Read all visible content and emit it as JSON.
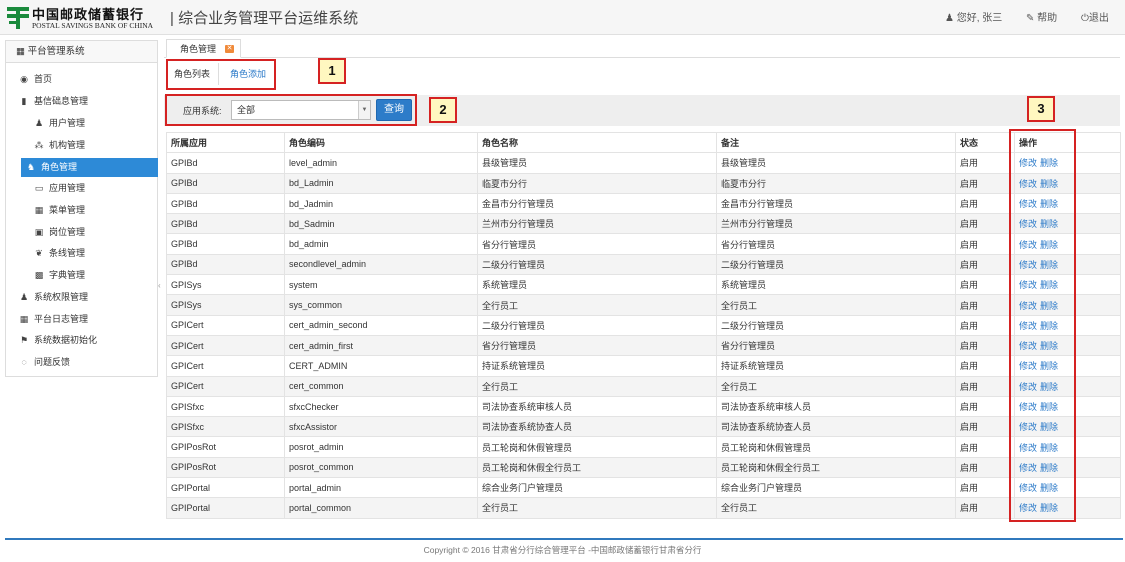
{
  "header": {
    "logo_cn": "中国邮政储蓄银行",
    "logo_en": "POSTAL SAVINGS BANK OF CHINA",
    "app_title": "| 综合业务管理平台运维系统",
    "user_greeting": "您好, 张三",
    "help": "帮助",
    "logout": "退出",
    "brand_color": "#1a8a3c"
  },
  "sidebar": {
    "title": "平台管理系统",
    "items": [
      {
        "icon": "globe-icon",
        "glyph": "◉",
        "label": "首页"
      },
      {
        "icon": "book-icon",
        "glyph": "▮",
        "label": "基信础息管理"
      },
      {
        "icon": "user-icon",
        "glyph": "♟",
        "label": "用户管理"
      },
      {
        "icon": "sitemap-icon",
        "glyph": "⁂",
        "label": "机构管理"
      },
      {
        "icon": "group-icon",
        "glyph": "♞",
        "label": "角色管理",
        "active": true
      },
      {
        "icon": "desktop-icon",
        "glyph": "▭",
        "label": "应用管理"
      },
      {
        "icon": "calendar-icon",
        "glyph": "▦",
        "label": "菜单管理"
      },
      {
        "icon": "briefcase-icon",
        "glyph": "▣",
        "label": "岗位管理"
      },
      {
        "icon": "leaf-icon",
        "glyph": "❦",
        "label": "条线管理"
      },
      {
        "icon": "grid-icon",
        "glyph": "▩",
        "label": "字典管理"
      },
      {
        "icon": "users-icon",
        "glyph": "♟",
        "label": "系统权限管理"
      },
      {
        "icon": "calendar-icon",
        "glyph": "▦",
        "label": "平台日志管理"
      },
      {
        "icon": "flag-icon",
        "glyph": "⚑",
        "label": "系统数据初始化"
      },
      {
        "icon": "comments-icon",
        "glyph": "◌",
        "label": "问题反馈"
      }
    ]
  },
  "tabs": {
    "main_tab": "角色管理",
    "sub_list": "角色列表",
    "sub_add": "角色添加"
  },
  "filter": {
    "label": "应用系统:",
    "selected": "全部",
    "query_button": "查询"
  },
  "table": {
    "headers": [
      "所属应用",
      "角色编码",
      "角色名称",
      "备注",
      "状态",
      "操作"
    ],
    "edit_label": "修改",
    "delete_label": "删除",
    "rows": [
      [
        "GPIBd",
        "level_admin",
        "县级管理员",
        "县级管理员",
        "启用"
      ],
      [
        "GPIBd",
        "bd_Ladmin",
        "临夏市分行",
        "临夏市分行",
        "启用"
      ],
      [
        "GPIBd",
        "bd_Jadmin",
        "金昌市分行管理员",
        "金昌市分行管理员",
        "启用"
      ],
      [
        "GPIBd",
        "bd_Sadmin",
        "兰州市分行管理员",
        "兰州市分行管理员",
        "启用"
      ],
      [
        "GPIBd",
        "bd_admin",
        "省分行管理员",
        "省分行管理员",
        "启用"
      ],
      [
        "GPIBd",
        "secondlevel_admin",
        "二级分行管理员",
        "二级分行管理员",
        "启用"
      ],
      [
        "GPISys",
        "system",
        "系统管理员",
        "系统管理员",
        "启用"
      ],
      [
        "GPISys",
        "sys_common",
        "全行员工",
        "全行员工",
        "启用"
      ],
      [
        "GPICert",
        "cert_admin_second",
        "二级分行管理员",
        "二级分行管理员",
        "启用"
      ],
      [
        "GPICert",
        "cert_admin_first",
        "省分行管理员",
        "省分行管理员",
        "启用"
      ],
      [
        "GPICert",
        "CERT_ADMIN",
        "持证系统管理员",
        "持证系统管理员",
        "启用"
      ],
      [
        "GPICert",
        "cert_common",
        "全行员工",
        "全行员工",
        "启用"
      ],
      [
        "GPISfxc",
        "sfxcChecker",
        "司法协查系统审核人员",
        "司法协查系统审核人员",
        "启用"
      ],
      [
        "GPISfxc",
        "sfxcAssistor",
        "司法协查系统协查人员",
        "司法协查系统协查人员",
        "启用"
      ],
      [
        "GPIPosRot",
        "posrot_admin",
        "员工轮岗和休假管理员",
        "员工轮岗和休假管理员",
        "启用"
      ],
      [
        "GPIPosRot",
        "posrot_common",
        "员工轮岗和休假全行员工",
        "员工轮岗和休假全行员工",
        "启用"
      ],
      [
        "GPIPortal",
        "portal_admin",
        "综合业务门户管理员",
        "综合业务门户管理员",
        "启用"
      ],
      [
        "GPIPortal",
        "portal_common",
        "全行员工",
        "全行员工",
        "启用"
      ]
    ]
  },
  "callouts": [
    "1",
    "2",
    "3"
  ],
  "footer": "Copyright © 2016 甘肃省分行综合管理平台 -中国邮政储蓄银行甘肃省分行"
}
